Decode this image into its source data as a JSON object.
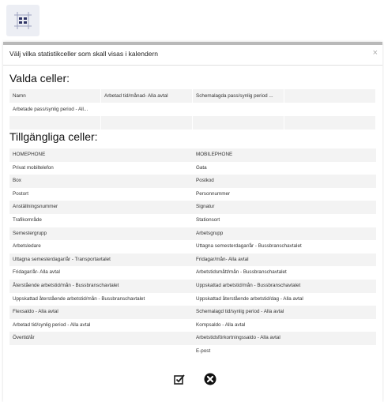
{
  "modal": {
    "title": "Välj vilka statistikceller som skall visas i kalendern",
    "close_glyph": "×"
  },
  "selected_section": {
    "title": "Valda celler:",
    "rows": [
      [
        "Namn",
        "Arbetad tid/månad- Alla avtal",
        "Schemalagda pass/synlig period ...",
        ""
      ],
      [
        "Arbetade pass/synlig period - All...",
        "",
        "",
        ""
      ],
      [
        "",
        "",
        "",
        ""
      ]
    ]
  },
  "available_section": {
    "title": "Tillgängliga celler:",
    "rows": [
      [
        "HOMEPHONE",
        "MOBILEPHONE"
      ],
      [
        "Privat mobiltelefon",
        "Gata"
      ],
      [
        "Box",
        "Postkod"
      ],
      [
        "Postort",
        "Personnummer"
      ],
      [
        "Anställningsnummer",
        "Signatur"
      ],
      [
        "Trafikområde",
        "Stationsort"
      ],
      [
        "Semestergrupp",
        "Arbetsgrupp"
      ],
      [
        "Arbetsledare",
        "Uttagna semesterdagar/år - Bussbranschavtalet"
      ],
      [
        "Uttagna semesterdagar/år - Transportavtalet",
        "Fridagar/mån- Alla avtal"
      ],
      [
        "Fridagar/år- Alla avtal",
        "Arbetstidsmått/mån - Bussbranschavtalet"
      ],
      [
        "Återstående arbetstid/mån - Bussbranschavtalet",
        "Uppskattad arbetstid/mån - Bussbranschavtalet"
      ],
      [
        "Uppskattad återstående arbetstid/mån - Bussbranschavtalet",
        "Uppskattad återstående arbetstid/dag - Alla avtal"
      ],
      [
        "Flexsaldo - Alla avtal",
        "Schemalagd tid/synlig period - Alla avtal"
      ],
      [
        "Arbetad tid/synlig period - Alla avtal",
        "Kompsaldo - Alla avtal"
      ],
      [
        "Övertid/år",
        "Arbetstidsförkortningssaldo - Alla avtal"
      ],
      [
        "",
        "E-post"
      ]
    ]
  },
  "icons": {
    "launcher": "calendar-grid-icon",
    "confirm": "checkbox-confirm-icon",
    "cancel": "circle-x-icon"
  }
}
